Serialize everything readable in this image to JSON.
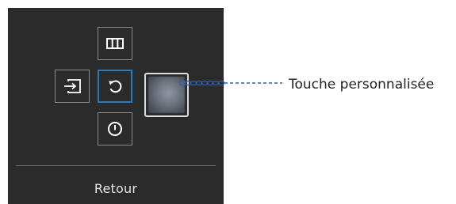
{
  "osd": {
    "footer_label": "Retour",
    "buttons": [
      {
        "icon": "picture-mode-icon",
        "state": "normal"
      },
      {
        "icon": "source-input-icon",
        "state": "normal"
      },
      {
        "icon": "return-icon",
        "state": "selected"
      },
      {
        "icon": "custom-key-icon",
        "state": "highlighted"
      },
      {
        "icon": "power-icon",
        "state": "normal"
      }
    ],
    "colors": {
      "panel": "#2b2b2b",
      "button_border": "#8a8a8a",
      "selected_border": "#2f79b7",
      "highlight_border": "#d9dde6",
      "callout_line": "#2f5fa8"
    }
  },
  "callout": {
    "label": "Touche personnalisée"
  }
}
